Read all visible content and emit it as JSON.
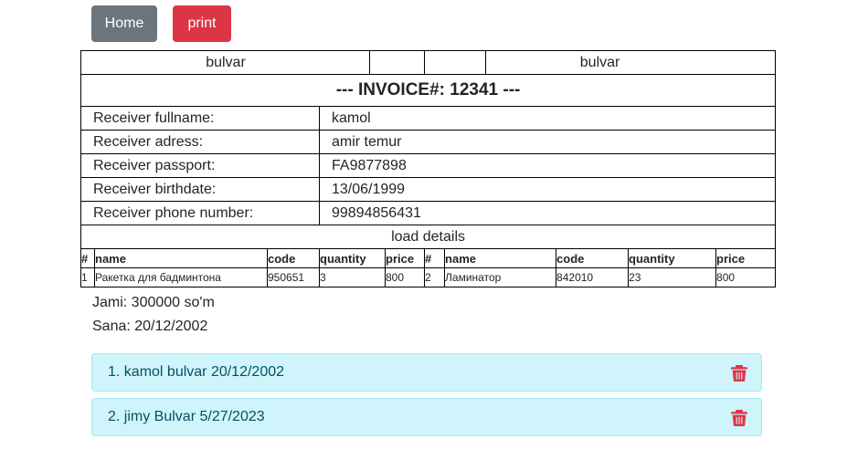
{
  "toolbar": {
    "home_label": "Home",
    "print_label": "print"
  },
  "invoice": {
    "header_left": "bulvar",
    "header_middle": "",
    "header_right": "bulvar",
    "title": "--- INVOICE#: 12341 ---",
    "fields": [
      {
        "label": "Receiver fullname:",
        "value": "kamol"
      },
      {
        "label": "Receiver adress:",
        "value": "amir temur"
      },
      {
        "label": "Receiver passport:",
        "value": "FA9877898"
      },
      {
        "label": "Receiver birthdate:",
        "value": "13/06/1999"
      },
      {
        "label": "Receiver phone number:",
        "value": "99894856431"
      }
    ],
    "load_details_label": "load details",
    "columns": [
      "#",
      "name",
      "code",
      "quantity",
      "price"
    ],
    "items": [
      {
        "no": "1",
        "name": "Ракетка для бадминтона",
        "code": "950651",
        "quantity": "3",
        "price": "800"
      },
      {
        "no": "2",
        "name": "Ламинатор",
        "code": "842010",
        "quantity": "23",
        "price": "800"
      }
    ]
  },
  "summary": {
    "total": "Jami: 300000 so'm",
    "date": "Sana: 20/12/2002"
  },
  "list": [
    {
      "text": "1. kamol bulvar 20/12/2002",
      "icon": "trash-icon"
    },
    {
      "text": "2. jimy Bulvar 5/27/2023",
      "icon": "trash-icon"
    }
  ],
  "colors": {
    "home_button": "#6c757d",
    "print_button": "#dc3545",
    "list_bg": "#cff4fc",
    "list_text": "#055160",
    "trash": "#dc3545"
  }
}
